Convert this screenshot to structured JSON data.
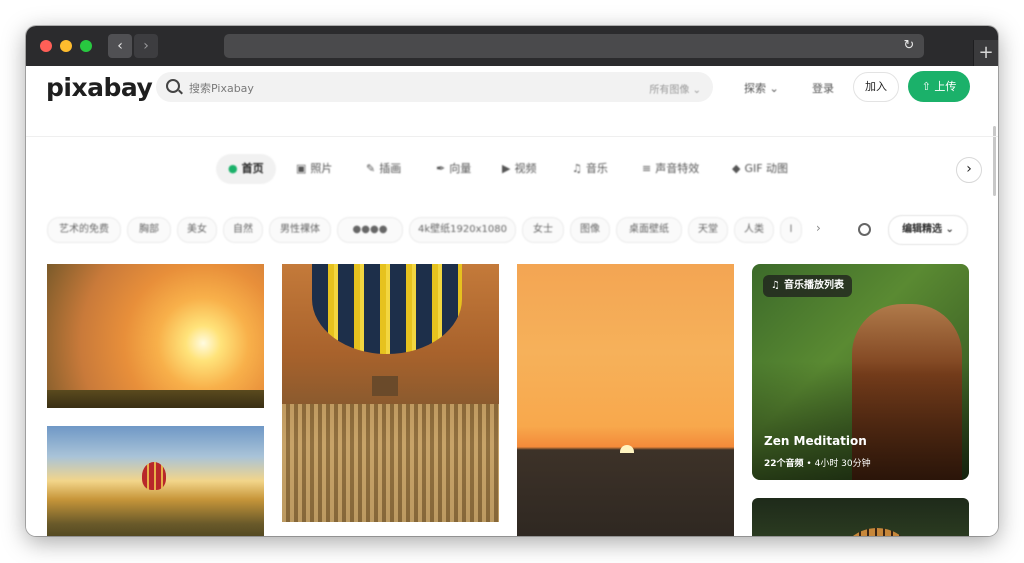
{
  "browser": {
    "back_icon": "chevron-left-icon",
    "forward_icon": "chevron-right-icon",
    "reload_icon": "reload-icon",
    "new_tab_label": "+"
  },
  "header": {
    "logo": "pixabay",
    "search_placeholder": "搜索Pixabay",
    "search_filter": "所有图像",
    "explore": "探索",
    "login": "登录",
    "join": "加入",
    "upload": "上传"
  },
  "categories": [
    {
      "label": "首页",
      "icon": "home-icon",
      "active": true
    },
    {
      "label": "照片",
      "icon": "camera-icon",
      "active": false
    },
    {
      "label": "插画",
      "icon": "pencil-icon",
      "active": false
    },
    {
      "label": "向量",
      "icon": "pen-icon",
      "active": false
    },
    {
      "label": "视频",
      "icon": "video-icon",
      "active": false
    },
    {
      "label": "音乐",
      "icon": "music-icon",
      "active": false
    },
    {
      "label": "声音特效",
      "icon": "sound-icon",
      "active": false
    },
    {
      "label": "GIF 动图",
      "icon": "gif-icon",
      "active": false
    }
  ],
  "tags": [
    "艺术的免费",
    "胸部",
    "美女",
    "自然",
    "男性裸体",
    "●●●●",
    "4k壁纸1920x1080",
    "女士",
    "图像",
    "桌面壁纸",
    "天堂",
    "人类",
    "ⅼ"
  ],
  "sort_label": "编辑精选",
  "music_tile": {
    "badge": "音乐播放列表",
    "title": "Zen Meditation",
    "tracks": "22个音频",
    "separator": "•",
    "duration": "4小时 30分钟"
  },
  "colors": {
    "accent": "#1bb16a",
    "titlebar": "#2b2b2d"
  }
}
